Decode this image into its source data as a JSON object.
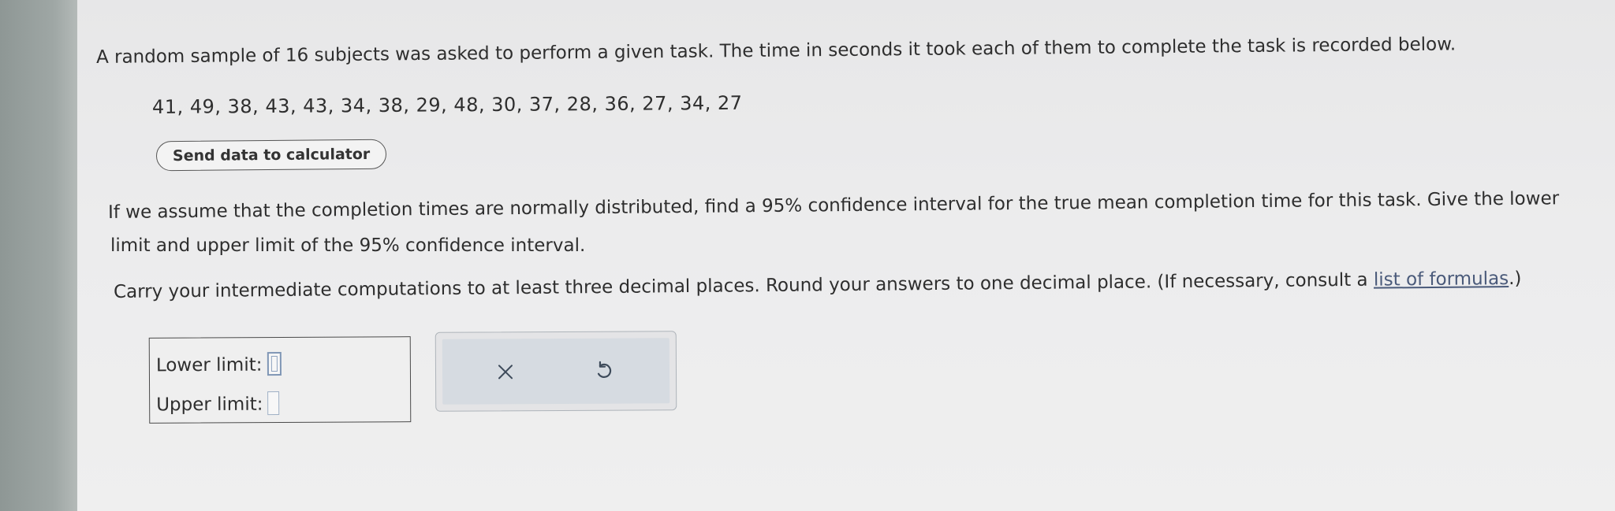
{
  "problem": {
    "intro": "A random sample of 16 subjects was asked to perform a given task. The time in seconds it took each of them to complete the task is recorded below.",
    "data_values": "41, 49, 38, 43, 43, 34, 38, 29, 48, 30, 37, 28, 36, 27, 34, 27",
    "send_button_label": "Send data to calculator",
    "question_line1": "If we assume that the completion times are normally distributed, find a 95% confidence interval for the true mean completion time for this task. Give the lower",
    "question_line2": "limit and upper limit of the 95% confidence interval.",
    "instructions_prefix": "Carry your intermediate computations to at least three decimal places. Round your answers to one decimal place. (If necessary, consult a ",
    "formula_link": "list of formulas",
    "instructions_suffix": ".)"
  },
  "answer": {
    "lower_label": "Lower limit:",
    "lower_value": "",
    "upper_label": "Upper limit:",
    "upper_value": ""
  },
  "actions": {
    "clear_icon": "x-icon",
    "undo_icon": "undo-icon"
  },
  "colors": {
    "link": "#4a5a7a",
    "input_border": "#9fb0c5",
    "panel_background": "#d6dbe1"
  }
}
